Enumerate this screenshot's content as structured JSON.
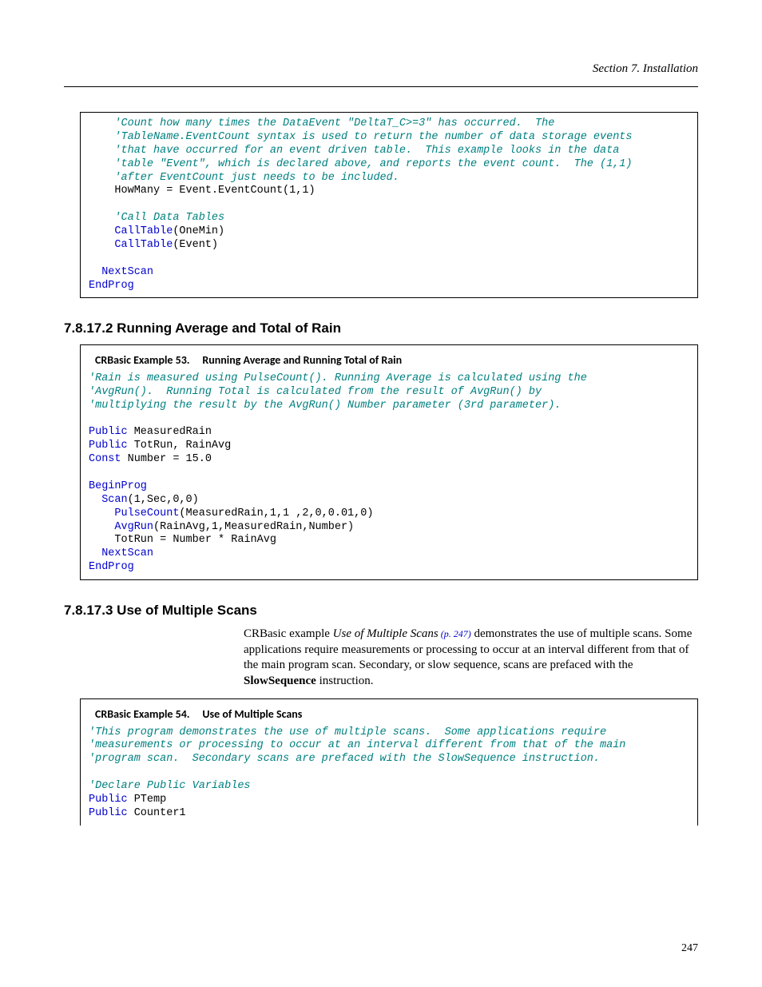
{
  "header": {
    "section_label": "Section 7.  Installation"
  },
  "code1": {
    "c1": "'Count how many times the DataEvent \"DeltaT_C>=3\" has occurred.  The",
    "c2": "'TableName.EventCount syntax is used to return the number of data storage events",
    "c3": "'that have occurred for an event driven table.  This example looks in the data",
    "c4": "'table \"Event\", which is declared above, and reports the event count.  The (1,1)",
    "c5": "'after EventCount just needs to be included.",
    "l1": "HowMany = Event.EventCount(1,1)",
    "c6": "'Call Data Tables",
    "k1": "CallTable",
    "l2": "(OneMin)",
    "l3": "(Event)",
    "k2": "NextScan",
    "k3": "EndProg"
  },
  "heading1": "7.8.17.2 Running Average and Total of Rain",
  "example53": {
    "label": "CRBasic Example 53.",
    "title": "Running Average and Running Total of Rain",
    "c1": "'Rain is measured using PulseCount(). Running Average is calculated using the",
    "c2": "'AvgRun().  Running Total is calculated from the result of AvgRun() by",
    "c3": "'multiplying the result by the AvgRun() Number parameter (3rd parameter).",
    "kPublic": "Public",
    "v1": " MeasuredRain",
    "v2": " TotRun, RainAvg",
    "kConst": "Const",
    "v3": " Number = 15.0",
    "kBeginProg": "BeginProg",
    "kScan": "Scan",
    "scanArgs": "(1,Sec,0,0)",
    "kPulseCount": "PulseCount",
    "pulseArgs": "(MeasuredRain,1,1 ,2,0,0.01,0)",
    "kAvgRun": "AvgRun",
    "avgArgs": "(RainAvg,1,MeasuredRain,Number)",
    "totrun": "TotRun = Number * RainAvg",
    "kNextScan": "NextScan",
    "kEndProg": "EndProg"
  },
  "heading2": "7.8.17.3 Use of Multiple Scans",
  "para": {
    "t1": "CRBasic example ",
    "italic": "Use of Multiple Scans",
    "link": " (p. 247)",
    "t2": " demonstrates the use of multiple scans.  Some applications require measurements or processing to occur at an interval different from that of the main program scan.  Secondary, or slow sequence, scans are prefaced with the ",
    "bold": "SlowSequence",
    "t3": " instruction."
  },
  "example54": {
    "label": "CRBasic Example 54.",
    "title": "Use of Multiple Scans",
    "c1": "'This program demonstrates the use of multiple scans.  Some applications require",
    "c2": "'measurements or processing to occur at an interval different from that of the main",
    "c3": "'program scan.  Secondary scans are prefaced with the SlowSequence instruction.",
    "c4": "'Declare Public Variables",
    "kPublic": "Public",
    "v1": " PTemp",
    "v2": " Counter1"
  },
  "page_number": "247"
}
